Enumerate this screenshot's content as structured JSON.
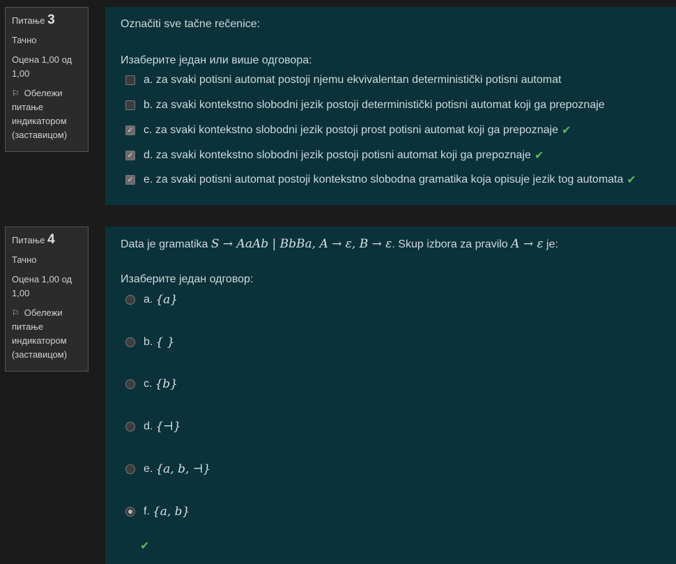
{
  "q3": {
    "label": "Питање",
    "number": "3",
    "state": "Тачно",
    "grade": "Оцена 1,00 од 1,00",
    "flag": "Обележи питање индикатором (заставицом)",
    "text": "Označiti sve tačne rečenice:",
    "prompt": "Изаберите један или више одговора:",
    "options": [
      {
        "label": "a. za svaki potisni automat postoji njemu ekvivalentan deterministički potisni automat",
        "checked": false,
        "correct": false
      },
      {
        "label": "b. za svaki kontekstno slobodni jezik postoji deterministički potisni automat koji ga prepoznaje",
        "checked": false,
        "correct": false
      },
      {
        "label": "c. za svaki kontekstno slobodni jezik postoji prost potisni automat koji ga prepoznaje",
        "checked": true,
        "correct": true
      },
      {
        "label": "d. za svaki kontekstno slobodni jezik postoji potisni automat koji ga prepoznaje",
        "checked": true,
        "correct": true
      },
      {
        "label": "e. za svaki potisni automat postoji kontekstno slobodna gramatika koja opisuje jezik tog automata",
        "checked": true,
        "correct": true
      }
    ]
  },
  "q4": {
    "label": "Питање",
    "number": "4",
    "state": "Тачно",
    "grade": "Оцена 1,00 од 1,00",
    "flag": "Обележи питање индикатором (заставицом)",
    "text_before": "Data je gramatika ",
    "grammar": "S → AaAb | BbBa,  A → ε,  B → ε",
    "text_middle": ". Skup izbora za pravilo ",
    "rule": "A → ε",
    "text_after": " je:",
    "prompt": "Изаберите један одговор:",
    "options": [
      {
        "letter": "a.",
        "set": "{a}",
        "selected": false
      },
      {
        "letter": "b.",
        "set": "{ }",
        "selected": false
      },
      {
        "letter": "c.",
        "set": "{b}",
        "selected": false
      },
      {
        "letter": "d.",
        "set": "{⊣}",
        "selected": false
      },
      {
        "letter": "e.",
        "set": "{a, b, ⊣}",
        "selected": false
      },
      {
        "letter": "f.",
        "set": "{a, b}",
        "selected": true
      }
    ]
  },
  "colors": {
    "correct": "#5cb85c",
    "content_bg": "#0b323b",
    "info_bg": "#2b2b2b"
  }
}
